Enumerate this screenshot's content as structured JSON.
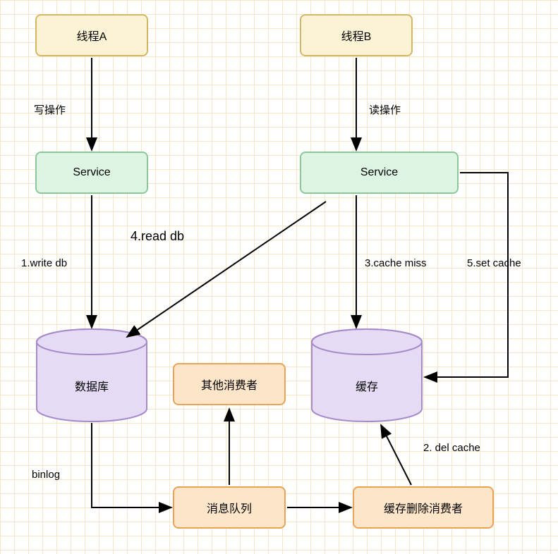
{
  "nodes": {
    "threadA": "线程A",
    "threadB": "线程B",
    "serviceA": "Service",
    "serviceB": "Service",
    "database": "数据库",
    "cache": "缓存",
    "otherConsumer": "其他消费者",
    "messageQueue": "消息队列",
    "cacheDeleteConsumer": "缓存删除消费者"
  },
  "edges": {
    "writeOp": "写操作",
    "readOp": "读操作",
    "writeDb": "1.write db",
    "readDb": "4.read db",
    "cacheMiss": "3.cache miss",
    "setCache": "5.set cache",
    "delCache": "2. del   cache",
    "binlog": "binlog"
  },
  "colors": {
    "yellowFill": "#fcf3d5",
    "yellowStroke": "#d4b764",
    "greenFill": "#def4e2",
    "greenStroke": "#8cc79a",
    "orangeFill": "#fce5c8",
    "orangeStroke": "#e8a356",
    "purpleFill": "#e6dbf4",
    "purpleStroke": "#a68bc9",
    "arrow": "#000000"
  }
}
